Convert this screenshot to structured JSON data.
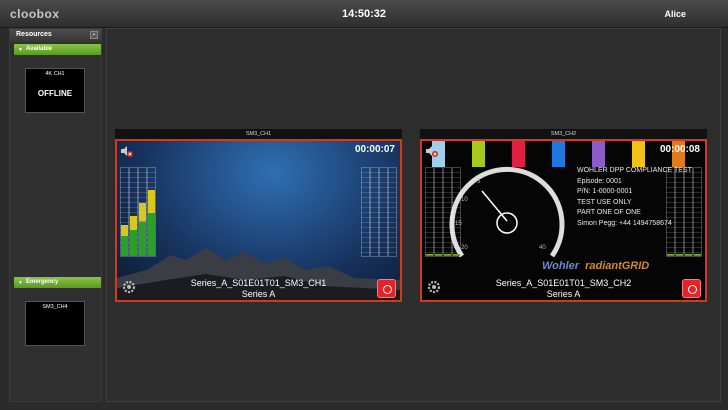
{
  "header": {
    "logo": "cloobox",
    "clock": "14:50:32",
    "user": "Alice"
  },
  "sidebar": {
    "title": "Resources",
    "minimize_icon": "minimize-icon",
    "groups": [
      {
        "label": "Available",
        "items": [
          {
            "title": "4K CH1",
            "status": "OFFLINE"
          }
        ]
      },
      {
        "label": "Emergency",
        "items": [
          {
            "title": "SM3_CH4",
            "status": ""
          }
        ]
      }
    ]
  },
  "tiles": [
    {
      "title": "SM3_CH1",
      "timer": "00:00:07",
      "clip_name": "Series_A_S01E01T01_SM3_CH1",
      "series": "Series A",
      "meter_levels_left": [
        0.35,
        0.45,
        0.6,
        0.75
      ],
      "meter_levels_right": [
        0,
        0,
        0,
        0
      ]
    },
    {
      "title": "SM3_CH2",
      "timer": "00:00:08",
      "clip_name": "Series_A_S01E01T01_SM3_CH2",
      "series": "Series A",
      "test_lines": [
        "WOHLER DPP COMPLIANCE TEST",
        "Episode: 0001",
        "P/N: 1-0000-0001",
        "TEST USE ONLY",
        "PART ONE OF ONE",
        "Simon Pegg: +44 1494758674"
      ],
      "brand_left": "Wohler",
      "brand_right": "radiantGRID",
      "dial_labels": [
        "5",
        "10",
        "15",
        "20",
        "40"
      ],
      "color_bars": [
        "#9fd0e8",
        "#a8c81e",
        "#e02040",
        "#1f7ae0",
        "#8b5bc7",
        "#f2c21b",
        "#e07a1a"
      ]
    }
  ],
  "colors": {
    "accent_green": "#8bc34a",
    "alert_red": "#d23a1a",
    "record_red": "#e0242a"
  }
}
